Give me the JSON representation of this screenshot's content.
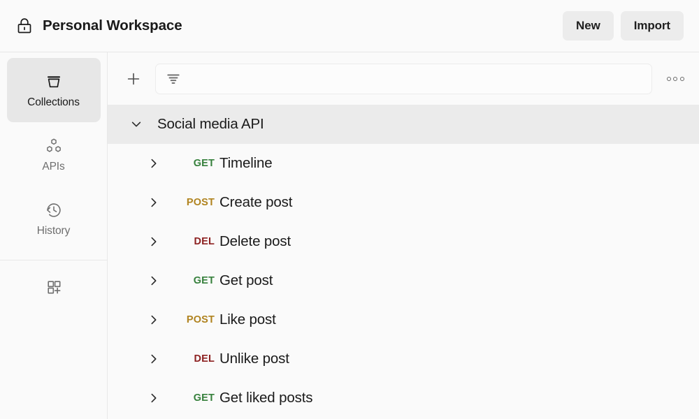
{
  "header": {
    "workspace_icon": "lock-icon",
    "title": "Personal Workspace",
    "new_label": "New",
    "import_label": "Import"
  },
  "sidebar": {
    "items": [
      {
        "id": "collections",
        "label": "Collections",
        "icon": "collections-icon",
        "active": true
      },
      {
        "id": "apis",
        "label": "APIs",
        "icon": "apis-hexagons-icon",
        "active": false
      },
      {
        "id": "history",
        "label": "History",
        "icon": "history-clock-icon",
        "active": false
      }
    ],
    "footer_item": {
      "id": "add-module",
      "icon": "grid-plus-icon"
    }
  },
  "toolbar": {
    "add_icon": "plus-icon",
    "filter_icon": "filter-icon",
    "search_value": "",
    "search_placeholder": "",
    "more_icon": "more-horizontal-icon"
  },
  "tree": {
    "collection": {
      "name": "Social media API",
      "expanded": true,
      "chevron": "chevron-down-icon"
    },
    "requests": [
      {
        "method": "GET",
        "method_class": "get",
        "name": "Timeline",
        "chevron": "chevron-right-icon"
      },
      {
        "method": "POST",
        "method_class": "post",
        "name": "Create post",
        "chevron": "chevron-right-icon"
      },
      {
        "method": "DEL",
        "method_class": "del",
        "name": "Delete post",
        "chevron": "chevron-right-icon"
      },
      {
        "method": "GET",
        "method_class": "get",
        "name": "Get post",
        "chevron": "chevron-right-icon"
      },
      {
        "method": "POST",
        "method_class": "post",
        "name": "Like post",
        "chevron": "chevron-right-icon"
      },
      {
        "method": "DEL",
        "method_class": "del",
        "name": "Unlike post",
        "chevron": "chevron-right-icon"
      },
      {
        "method": "GET",
        "method_class": "get",
        "name": "Get liked posts",
        "chevron": "chevron-right-icon"
      }
    ]
  },
  "colors": {
    "get": "#36803c",
    "post": "#b0831f",
    "del": "#8d2222",
    "page_bg": "#fafafa",
    "row_highlight": "#ebebeb",
    "rail_active": "#e7e7e7",
    "button_bg": "#ececec"
  }
}
